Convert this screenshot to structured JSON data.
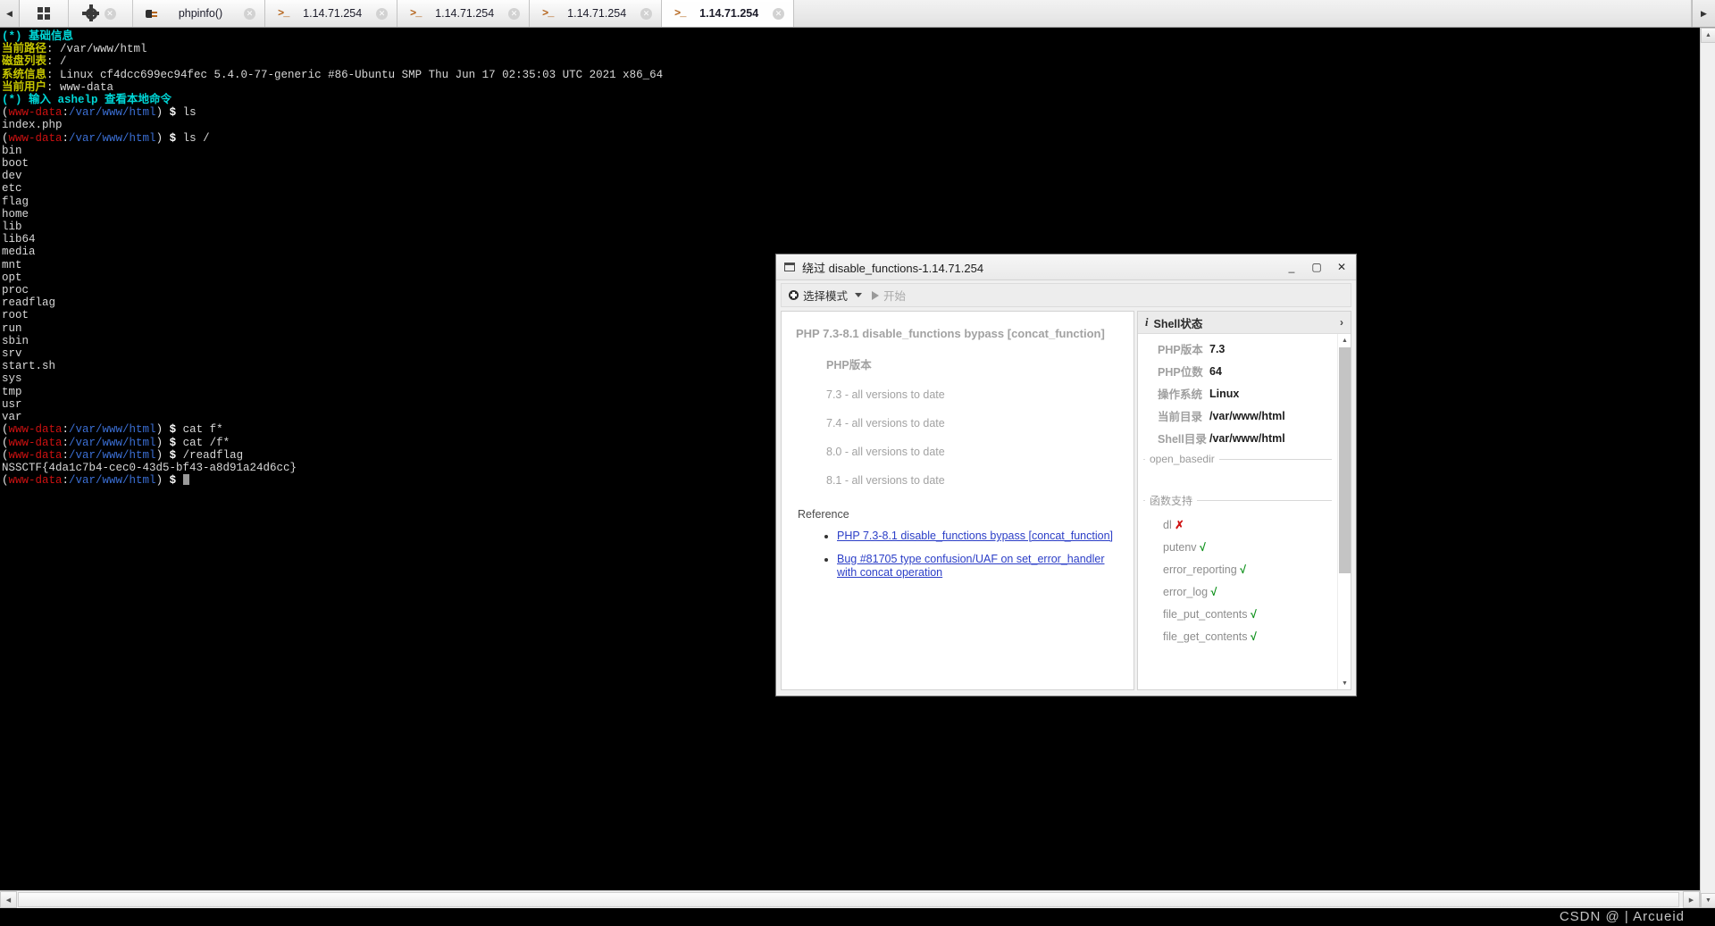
{
  "tabbar": {
    "scroll_left": "◀",
    "scroll_right": "▶",
    "grid_button": "grid",
    "gear_button": "settings",
    "close_glyph": "✕",
    "tabs": [
      {
        "label": "phpinfo()",
        "icon": "php-icon",
        "active": false
      },
      {
        "label": "1.14.71.254",
        "icon": "terminal-icon",
        "active": false
      },
      {
        "label": "1.14.71.254",
        "icon": "terminal-icon",
        "active": false
      },
      {
        "label": "1.14.71.254",
        "icon": "terminal-icon",
        "active": false
      },
      {
        "label": "1.14.71.254",
        "icon": "terminal-icon",
        "active": true
      }
    ]
  },
  "terminal": {
    "banner_title": "(*) 基础信息",
    "rows": [
      {
        "label": "当前路径",
        "value": "/var/www/html"
      },
      {
        "label": "磁盘列表",
        "value": "/"
      },
      {
        "label": "系统信息",
        "value": "Linux cf4dcc699ec94fec 5.4.0-77-generic #86-Ubuntu SMP Thu Jun 17 02:35:03 UTC 2021 x86_64"
      },
      {
        "label": "当前用户",
        "value": "www-data"
      }
    ],
    "help_hint": "(*) 输入 ashelp 查看本地命令",
    "user": "www-data",
    "cwd": "/var/www/html",
    "prompt_sign": "$",
    "commands": [
      {
        "cmd": "ls",
        "output": [
          "index.php"
        ]
      },
      {
        "cmd": "ls /",
        "output": [
          "bin",
          "boot",
          "dev",
          "etc",
          "flag",
          "home",
          "lib",
          "lib64",
          "media",
          "mnt",
          "opt",
          "proc",
          "readflag",
          "root",
          "run",
          "sbin",
          "srv",
          "start.sh",
          "sys",
          "tmp",
          "usr",
          "var"
        ]
      },
      {
        "cmd": "cat f*",
        "output": []
      },
      {
        "cmd": "cat /f*",
        "output": []
      },
      {
        "cmd": "/readflag",
        "output": [
          "NSSCTF{4da1c7b4-cec0-43d5-bf43-a8d91a24d6cc}"
        ]
      }
    ],
    "final_prompt": true
  },
  "watermark": "CSDN @ | Arcueid",
  "dialog": {
    "title": "绕过 disable_functions-1.14.71.254",
    "minimize": "_",
    "maximize": "▢",
    "close": "✕",
    "toolbar": {
      "mode_label": "选择模式",
      "start_label": "开始"
    },
    "doc": {
      "heading": "PHP 7.3-8.1 disable_functions bypass [concat_function]",
      "sub_heading": "PHP版本",
      "versions": [
        "7.3 - all versions to date",
        "7.4 - all versions to date",
        "8.0 - all versions to date",
        "8.1 - all versions to date"
      ],
      "reference_label": "Reference",
      "links": [
        "PHP 7.3-8.1 disable_functions bypass [concat_function]",
        "Bug #81705 type confusion/UAF on set_error_handler with concat operation"
      ]
    },
    "state": {
      "header": "Shell状态",
      "header_icon": "i",
      "expand_icon": "›",
      "items": [
        {
          "key": "PHP版本",
          "value": "7.3"
        },
        {
          "key": "PHP位数",
          "value": "64"
        },
        {
          "key": "操作系统",
          "value": "Linux"
        },
        {
          "key": "当前目录",
          "value": "/var/www/html"
        },
        {
          "key": "Shell目录",
          "value": "/var/www/html"
        }
      ],
      "basedir_legend": "open_basedir",
      "basedir_value": "",
      "functions_legend": "函数支持",
      "functions": [
        {
          "name": "dl",
          "supported": false,
          "mark": "✗"
        },
        {
          "name": "putenv",
          "supported": true,
          "mark": "√"
        },
        {
          "name": "error_reporting",
          "supported": true,
          "mark": "√"
        },
        {
          "name": "error_log",
          "supported": true,
          "mark": "√"
        },
        {
          "name": "file_put_contents",
          "supported": true,
          "mark": "√"
        },
        {
          "name": "file_get_contents",
          "supported": true,
          "mark": "√"
        }
      ]
    }
  },
  "colors": {
    "cyan": "#00d7d7",
    "yellow": "#c5c500",
    "red": "#cc1111",
    "blue": "#3b6fd4",
    "link": "#2b3ec7",
    "ok_green": "#0a8f17",
    "err_red": "#d01414"
  }
}
